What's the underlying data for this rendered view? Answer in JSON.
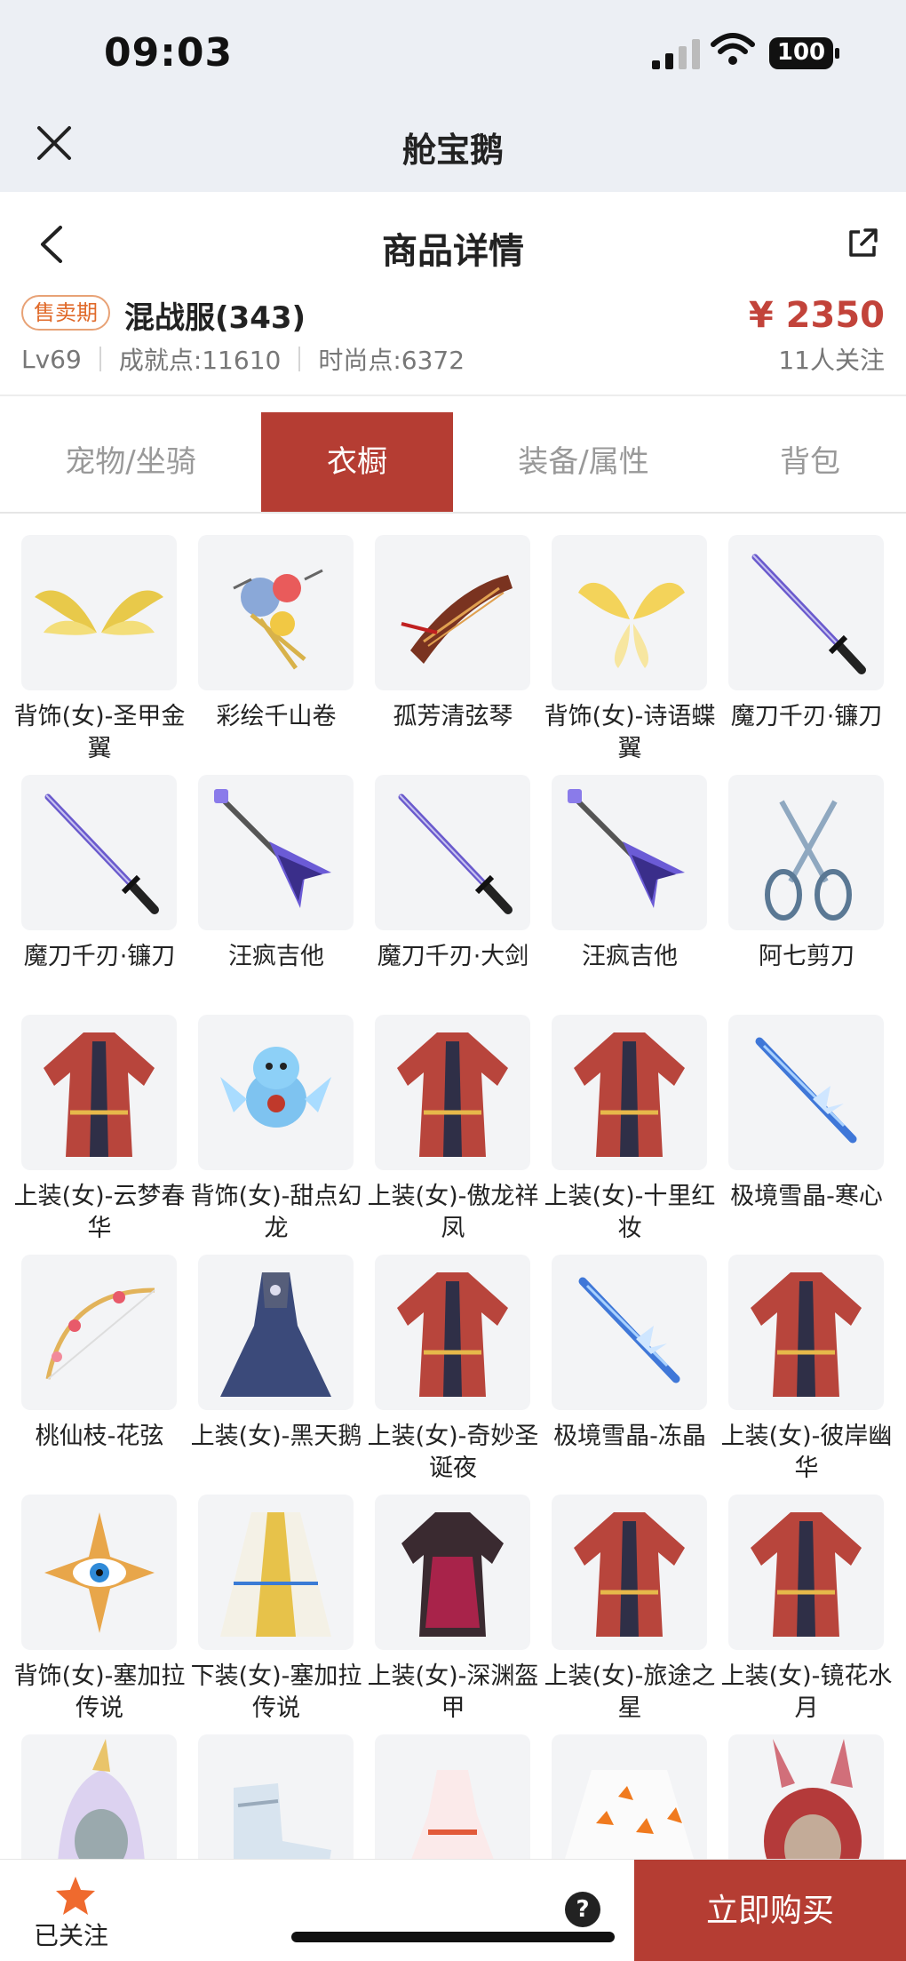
{
  "status_bar": {
    "time": "09:03",
    "battery": "100"
  },
  "app": {
    "title": "舱宝鹅"
  },
  "page": {
    "title": "商品详情"
  },
  "product": {
    "badge": "售卖期",
    "name": "混战服(343)",
    "price": "¥ 2350",
    "level": "Lv69",
    "achievement": "成就点:11610",
    "fashion": "时尚点:6372",
    "followers": "11人关注"
  },
  "tabs": [
    {
      "label": "宠物/坐骑",
      "active": false
    },
    {
      "label": "衣橱",
      "active": true
    },
    {
      "label": "装备/属性",
      "active": false
    },
    {
      "label": "背包",
      "active": false
    }
  ],
  "colors": {
    "accent": "#b53d33",
    "price": "#c2433a",
    "badge": "#e06a2a",
    "star": "#ef6a2e"
  },
  "items": [
    {
      "name": "背饰(女)-圣甲金翼",
      "icon": "golden-wings-icon"
    },
    {
      "name": "彩绘千山卷",
      "icon": "painted-scroll-icon"
    },
    {
      "name": "孤芳清弦琴",
      "icon": "zither-icon"
    },
    {
      "name": "背饰(女)-诗语蝶翼",
      "icon": "butterfly-wings-icon"
    },
    {
      "name": "魔刀千刃·镰刀",
      "icon": "katana-icon"
    },
    {
      "name": "魔刀千刃·镰刀",
      "icon": "katana-icon"
    },
    {
      "name": "汪疯吉他",
      "icon": "guitar-icon"
    },
    {
      "name": "魔刀千刃·大剑",
      "icon": "katana-icon"
    },
    {
      "name": "汪疯吉他",
      "icon": "guitar-icon"
    },
    {
      "name": "阿七剪刀",
      "icon": "scissors-icon"
    },
    {
      "name": "上装(女)-云梦春华",
      "icon": "robe-icon"
    },
    {
      "name": "背饰(女)-甜点幻龙",
      "icon": "dragon-pet-icon"
    },
    {
      "name": "上装(女)-傲龙祥凤",
      "icon": "robe-icon"
    },
    {
      "name": "上装(女)-十里红妆",
      "icon": "robe-icon"
    },
    {
      "name": "极境雪晶-寒心",
      "icon": "ice-sword-icon"
    },
    {
      "name": "桃仙枝-花弦",
      "icon": "flower-bow-icon"
    },
    {
      "name": "上装(女)-黑天鹅",
      "icon": "gown-icon"
    },
    {
      "name": "上装(女)-奇妙圣诞夜",
      "icon": "robe-icon"
    },
    {
      "name": "极境雪晶-冻晶",
      "icon": "ice-sword-icon"
    },
    {
      "name": "上装(女)-彼岸幽华",
      "icon": "robe-icon"
    },
    {
      "name": "背饰(女)-塞加拉传说",
      "icon": "eye-emblem-icon"
    },
    {
      "name": "下装(女)-塞加拉传说",
      "icon": "skirt-icon"
    },
    {
      "name": "上装(女)-深渊盔甲",
      "icon": "armor-icon"
    },
    {
      "name": "上装(女)-旅途之星",
      "icon": "robe-icon"
    },
    {
      "name": "上装(女)-镜花水月",
      "icon": "robe-icon"
    },
    {
      "name": "",
      "icon": "unicorn-hood-icon"
    },
    {
      "name": "",
      "icon": "armor-boots-icon"
    },
    {
      "name": "",
      "icon": "dress-icon"
    },
    {
      "name": "",
      "icon": "maple-skirt-icon"
    },
    {
      "name": "",
      "icon": "bunny-hood-icon"
    }
  ],
  "bottom": {
    "followed_label": "已关注",
    "help": "?",
    "buy_label": "立即购买"
  }
}
